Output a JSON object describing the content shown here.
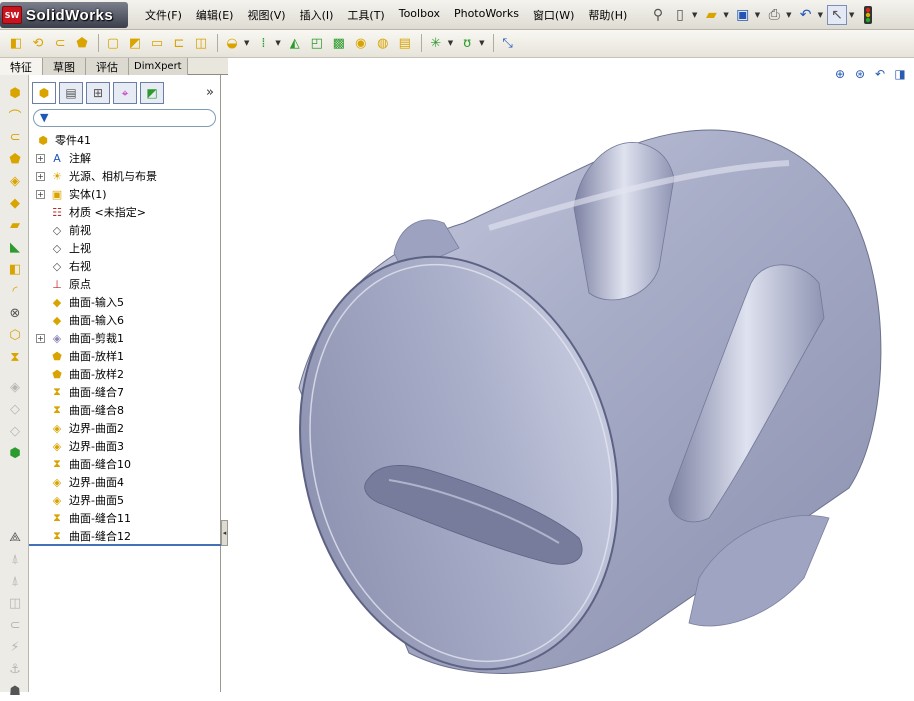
{
  "app": {
    "logo_badge": "SW",
    "logo_text": "SolidWorks"
  },
  "menu": [
    "文件(F)",
    "编辑(E)",
    "视图(V)",
    "插入(I)",
    "工具(T)",
    "Toolbox",
    "PhotoWorks",
    "窗口(W)",
    "帮助(H)"
  ],
  "quick_access": [
    "pin-icon",
    "new-document-icon",
    "open-folder-icon",
    "save-icon",
    "print-icon",
    "undo-icon",
    "select-pointer-icon",
    "rebuild-traffic-light-icon"
  ],
  "feature_toolbar": [
    "boss-extrude-icon",
    "revolve-icon",
    "sweep-icon",
    "loft-icon",
    "fillet-icon",
    "chamfer-icon",
    "shell-icon",
    "rib-icon",
    "draft-icon",
    "dome-icon",
    "linear-pattern-icon",
    "mirror-icon",
    "wrap-icon",
    "intersect-icon",
    "curves-icon",
    "reference-geometry-icon",
    "instant3d-icon"
  ],
  "command_tabs": [
    "特征",
    "草图",
    "评估",
    "DimXpert"
  ],
  "active_tab": "特征",
  "fm_tabs": [
    "feature-manager-icon",
    "property-manager-icon",
    "configuration-manager-icon",
    "dimxpert-manager-icon",
    "display-manager-icon"
  ],
  "fm_more": "»",
  "tree": [
    {
      "label": "零件41",
      "icon": "part-icon",
      "level": 0,
      "expand": false
    },
    {
      "label": "注解",
      "icon": "annotations-icon",
      "level": 1,
      "expand": true
    },
    {
      "label": "光源、相机与布景",
      "icon": "lights-cameras-icon",
      "level": 1,
      "expand": true
    },
    {
      "label": "实体(1)",
      "icon": "solid-bodies-icon",
      "level": 1,
      "expand": true
    },
    {
      "label": "材质 <未指定>",
      "icon": "material-icon",
      "level": 1,
      "expand": false
    },
    {
      "label": "前视",
      "icon": "plane-icon",
      "level": 1,
      "expand": false
    },
    {
      "label": "上视",
      "icon": "plane-icon",
      "level": 1,
      "expand": false
    },
    {
      "label": "右视",
      "icon": "plane-icon",
      "level": 1,
      "expand": false
    },
    {
      "label": "原点",
      "icon": "origin-icon",
      "level": 1,
      "expand": false
    },
    {
      "label": "曲面-输入5",
      "icon": "imported-surface-icon",
      "level": 1,
      "expand": false
    },
    {
      "label": "曲面-输入6",
      "icon": "imported-surface-icon",
      "level": 1,
      "expand": false
    },
    {
      "label": "曲面-剪裁1",
      "icon": "trim-surface-icon",
      "level": 1,
      "expand": true
    },
    {
      "label": "曲面-放样1",
      "icon": "loft-surface-icon",
      "level": 1,
      "expand": false
    },
    {
      "label": "曲面-放样2",
      "icon": "loft-surface-icon",
      "level": 1,
      "expand": false
    },
    {
      "label": "曲面-缝合7",
      "icon": "knit-surface-icon",
      "level": 1,
      "expand": false
    },
    {
      "label": "曲面-缝合8",
      "icon": "knit-surface-icon",
      "level": 1,
      "expand": false
    },
    {
      "label": "边界-曲面2",
      "icon": "boundary-surface-icon",
      "level": 1,
      "expand": false
    },
    {
      "label": "边界-曲面3",
      "icon": "boundary-surface-icon",
      "level": 1,
      "expand": false
    },
    {
      "label": "曲面-缝合10",
      "icon": "knit-surface-icon",
      "level": 1,
      "expand": false
    },
    {
      "label": "边界-曲面4",
      "icon": "boundary-surface-icon",
      "level": 1,
      "expand": false
    },
    {
      "label": "边界-曲面5",
      "icon": "boundary-surface-icon",
      "level": 1,
      "expand": false
    },
    {
      "label": "曲面-缝合11",
      "icon": "knit-surface-icon",
      "level": 1,
      "expand": false
    },
    {
      "label": "曲面-缝合12",
      "icon": "knit-surface-icon",
      "level": 1,
      "expand": false
    }
  ],
  "viewport_tools": [
    "zoom-to-fit-icon",
    "zoom-to-area-icon",
    "previous-view-icon",
    "section-view-icon"
  ],
  "model": {
    "color": "#a9adc4",
    "shade": "#6c718d",
    "highlight": "#dde0ee"
  }
}
